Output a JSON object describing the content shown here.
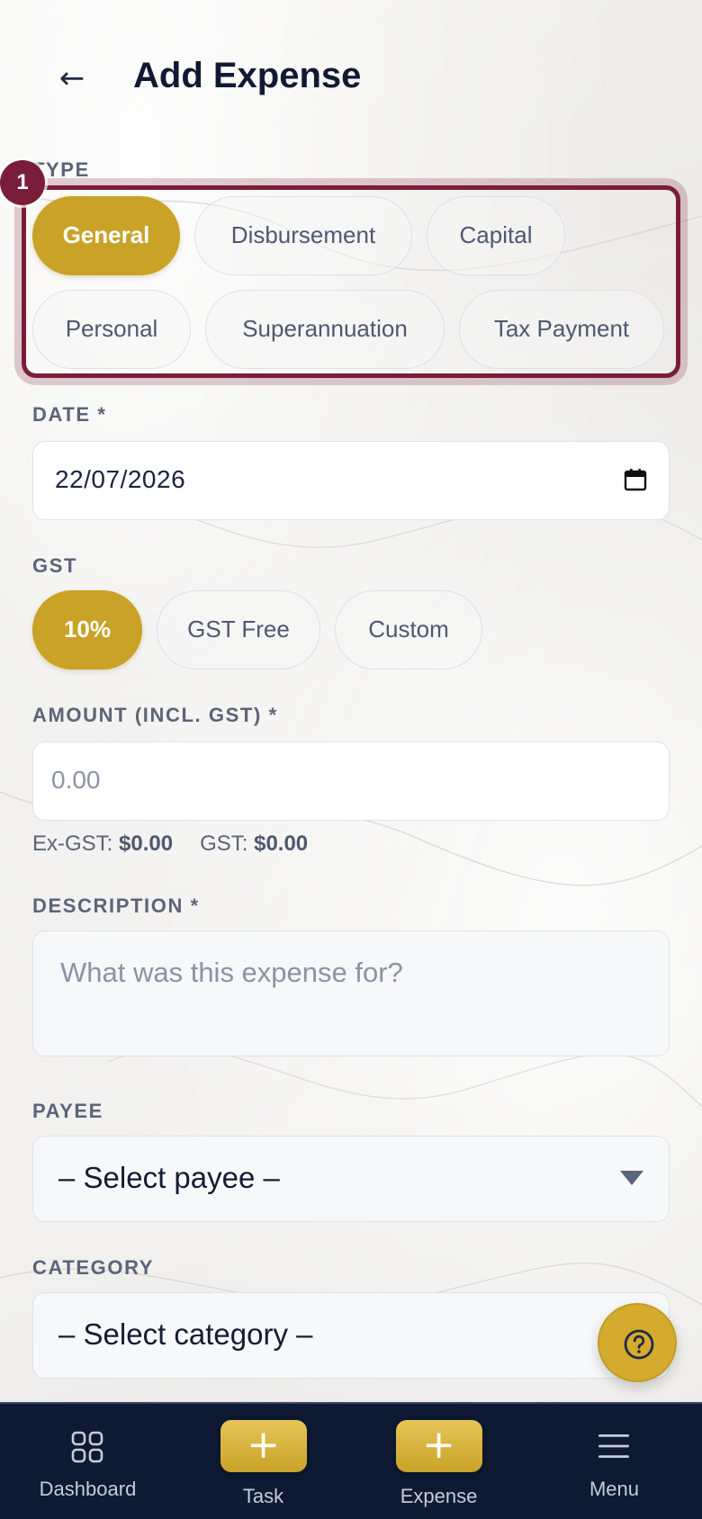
{
  "header": {
    "back_icon": "←",
    "title": "Add Expense"
  },
  "type_section": {
    "label": "TYPE",
    "step_badge": "1",
    "options": [
      {
        "label": "General",
        "selected": true
      },
      {
        "label": "Disbursement",
        "selected": false
      },
      {
        "label": "Capital",
        "selected": false
      },
      {
        "label": "Personal",
        "selected": false
      },
      {
        "label": "Superannuation",
        "selected": false
      },
      {
        "label": "Tax Payment",
        "selected": false
      }
    ]
  },
  "date": {
    "label": "DATE *",
    "value": "22/07/2026",
    "icon": "calendar-icon"
  },
  "gst": {
    "label": "GST",
    "options": [
      {
        "label": "10%",
        "selected": true
      },
      {
        "label": "GST Free",
        "selected": false
      },
      {
        "label": "Custom",
        "selected": false
      }
    ]
  },
  "amount": {
    "label": "AMOUNT (INCL. GST) *",
    "placeholder": "0.00",
    "ex_gst_label": "Ex-GST:",
    "ex_gst_value": "$0.00",
    "gst_label": "GST:",
    "gst_value": "$0.00"
  },
  "description": {
    "label": "DESCRIPTION *",
    "placeholder": "What was this expense for?"
  },
  "payee": {
    "label": "PAYEE",
    "selected": "– Select payee –"
  },
  "category": {
    "label": "CATEGORY",
    "selected": "– Select category –"
  },
  "help_button": {
    "icon": "question-circle-icon"
  },
  "bottom_nav": {
    "items": [
      {
        "label": "Dashboard",
        "icon": "grid-icon"
      },
      {
        "label": "Task",
        "icon": "plus-icon"
      },
      {
        "label": "Expense",
        "icon": "plus-icon"
      },
      {
        "label": "Menu",
        "icon": "hamburger-icon"
      }
    ]
  },
  "colors": {
    "accent_gold": "#c9a227",
    "highlight_maroon": "#7a1d3b",
    "nav_background": "#0e1a33",
    "title_text": "#111a33"
  }
}
